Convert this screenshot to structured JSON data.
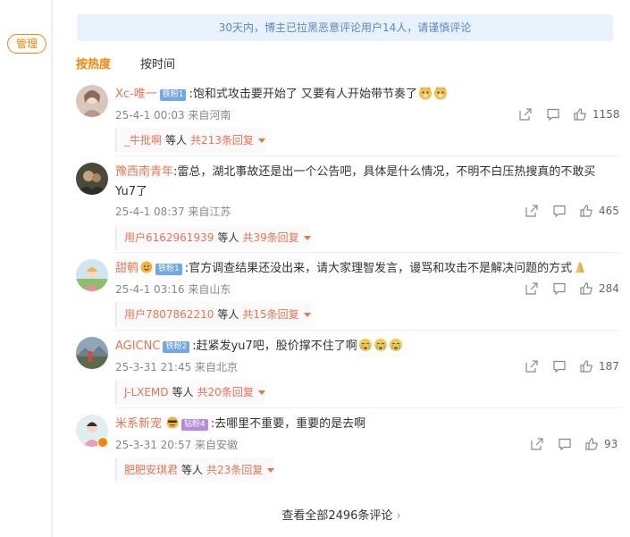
{
  "sidebar": {
    "manage_label": "管理"
  },
  "notice": {
    "text": "30天内，博主已拉黑恶意评论用户14人，请谨慎评论"
  },
  "sort": {
    "hot_label": "按热度",
    "time_label": "按时间"
  },
  "comments": [
    {
      "user": "Xc-唯一",
      "badge": "铁粉1",
      "text": ":饱和式攻击要开始了 又要有人开始带节奏了",
      "emojis": [
        "doge-emoji",
        "doge-emoji"
      ],
      "time": "25-4-1 00:03 来自河南",
      "likes": "1158",
      "reply_user": "_牛批啊",
      "reply_mid": "等人",
      "reply_count": "共213条回复"
    },
    {
      "user": "豫西南青年",
      "badge": "",
      "text": ":雷总，湖北事故还是出一个公告吧，具体是什么情况，不明不白压热搜真的不敢买Yu7了",
      "emojis": [],
      "time": "25-4-1 08:37 来自江苏",
      "likes": "465",
      "reply_user": "用户6162961939",
      "reply_mid": "等人",
      "reply_count": "共39条回复"
    },
    {
      "user": "甜鹌",
      "badge": "铁粉1",
      "text": ":官方调查结果还没出来，请大家理智发言，谩骂和攻击不是解决问题的方式",
      "emojis": [
        "pray-emoji"
      ],
      "time": "25-4-1 03:16 来自山东",
      "likes": "284",
      "reply_user": "用户7807862210",
      "reply_mid": "等人",
      "reply_count": "共15条回复"
    },
    {
      "user": "AGICNC",
      "badge": "铁粉2",
      "text": ":赶紧发yu7吧，股价撑不住了啊",
      "emojis": [
        "cry-emoji",
        "cry-emoji",
        "cry-emoji"
      ],
      "time": "25-3-31 21:45 来自北京",
      "likes": "187",
      "reply_user": "J-LXEMD",
      "reply_mid": "等人",
      "reply_count": "共20条回复"
    },
    {
      "user": "米系新宠",
      "badge": "钻粉4",
      "text": ":去哪里不重要，重要的是去啊",
      "emojis": [],
      "time": "25-3-31 20:57 来自安徽",
      "likes": "93",
      "reply_user": "肥肥安琪君",
      "reply_mid": "等人",
      "reply_count": "共23条回复"
    }
  ],
  "footer": {
    "view_all": "查看全部2496条评论",
    "chevron": "›"
  },
  "colors": {
    "accent": "#ff8200",
    "username": "#eb7350",
    "notice_bg": "#e8f2fd",
    "notice_text": "#5b87c4",
    "badge_blue": "#6fa8e8"
  },
  "icons": [
    "share-icon",
    "comment-icon",
    "like-icon"
  ]
}
